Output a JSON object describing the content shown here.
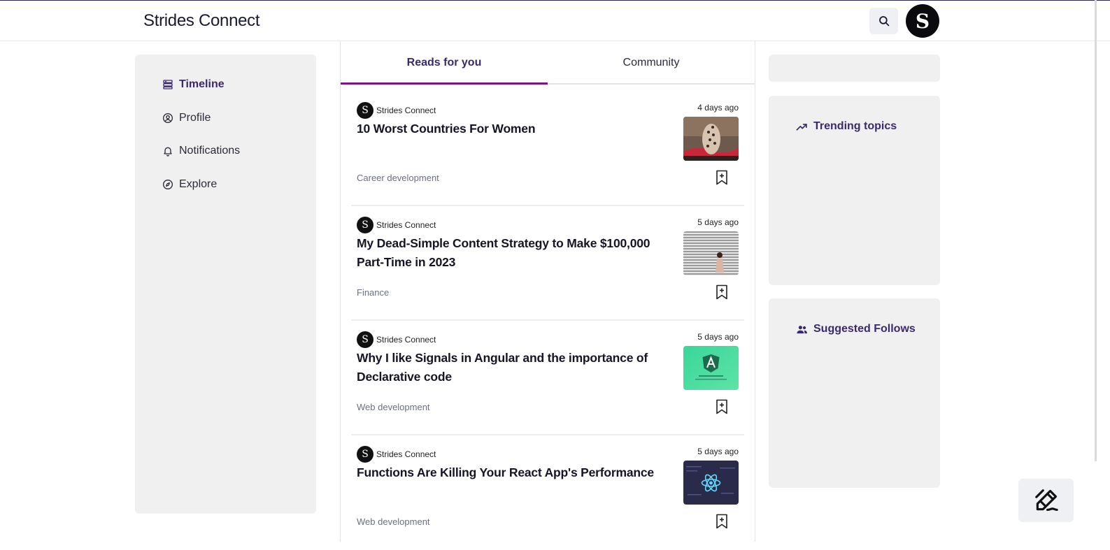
{
  "app": {
    "title": "Strides Connect",
    "avatar_letter": "S"
  },
  "header": {
    "search_icon": "search-icon"
  },
  "sidebar": {
    "items": [
      {
        "label": "Timeline",
        "icon": "timeline-icon",
        "active": true
      },
      {
        "label": "Profile",
        "icon": "user-circle-icon",
        "active": false
      },
      {
        "label": "Notifications",
        "icon": "bell-icon",
        "active": false
      },
      {
        "label": "Explore",
        "icon": "compass-icon",
        "active": false
      }
    ]
  },
  "feed": {
    "tabs": [
      {
        "label": "Reads for you",
        "active": true
      },
      {
        "label": "Community",
        "active": false
      }
    ],
    "posts": [
      {
        "author": "Strides Connect",
        "author_initial": "S",
        "time": "4 days ago",
        "title": "10 Worst Countries For Women",
        "category": "Career development"
      },
      {
        "author": "Strides Connect",
        "author_initial": "S",
        "time": "5 days ago",
        "title": "My Dead-Simple Content Strategy to Make $100,000 Part-Time in 2023",
        "category": "Finance"
      },
      {
        "author": "Strides Connect",
        "author_initial": "S",
        "time": "5 days ago",
        "title": "Why I like Signals in Angular and the importance of Declarative code",
        "category": "Web development"
      },
      {
        "author": "Strides Connect",
        "author_initial": "S",
        "time": "5 days ago",
        "title": "Functions Are Killing Your React App's Performance",
        "category": "Web development"
      }
    ]
  },
  "right": {
    "trending": {
      "label": "Trending topics",
      "icon": "trending-up-icon"
    },
    "suggested": {
      "label": "Suggested Follows",
      "icon": "users-icon"
    }
  },
  "fab": {
    "icon": "compose-icon"
  },
  "colors": {
    "accent": "#3b2a6b",
    "tab_underline": "#7b1583",
    "panel": "#f0f0f0"
  }
}
